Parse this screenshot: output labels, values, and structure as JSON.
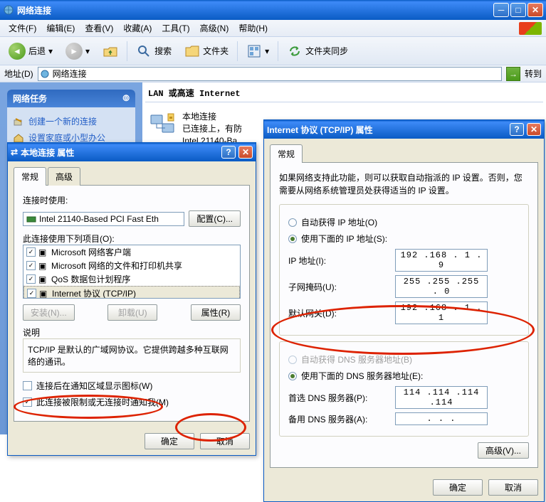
{
  "window": {
    "title": "网络连接"
  },
  "menu": {
    "file": "文件(F)",
    "edit": "编辑(E)",
    "view": "查看(V)",
    "favorites": "收藏(A)",
    "tools": "工具(T)",
    "advanced": "高级(N)",
    "help": "帮助(H)"
  },
  "toolbar": {
    "back": "后退",
    "search": "搜索",
    "folders": "文件夹",
    "sync": "文件夹同步"
  },
  "address": {
    "label": "地址(D)",
    "value": "网络连接",
    "go": "转到"
  },
  "tasks": {
    "header": "网络任务",
    "create": "创建一个新的连接",
    "setup": "设置家庭或小型办公"
  },
  "content": {
    "group": "LAN 或高速 Internet",
    "conn": {
      "name": "本地连接",
      "status": "已连接上，有防",
      "adapter": "Intel 21140-Ba"
    }
  },
  "props": {
    "title": "本地连接 属性",
    "tab_general": "常规",
    "tab_advanced": "高级",
    "connect_using": "连接时使用:",
    "adapter": "Intel 21140-Based PCI Fast Eth",
    "configure": "配置(C)...",
    "uses_items": "此连接使用下列项目(O):",
    "items": [
      "Microsoft 网络客户端",
      "Microsoft 网络的文件和打印机共享",
      "QoS 数据包计划程序",
      "Internet 协议 (TCP/IP)"
    ],
    "install": "安装(N)...",
    "uninstall": "卸载(U)",
    "properties": "属性(R)",
    "desc_label": "说明",
    "desc": "TCP/IP 是默认的广域网协议。它提供跨越多种互联网络的通讯。",
    "show_tray": "连接后在通知区域显示图标(W)",
    "notify": "此连接被限制或无连接时通知我(M)",
    "ok": "确定",
    "cancel": "取消"
  },
  "tcpip": {
    "title": "Internet 协议 (TCP/IP) 属性",
    "tab_general": "常规",
    "intro": "如果网络支持此功能，则可以获取自动指派的 IP 设置。否则，您需要从网络系统管理员处获得适当的 IP 设置。",
    "auto_ip": "自动获得 IP 地址(O)",
    "use_ip": "使用下面的 IP 地址(S):",
    "ip_label": "IP 地址(I):",
    "ip_value": "192 .168 . 1  . 9",
    "mask_label": "子网掩码(U):",
    "mask_value": "255 .255 .255 . 0",
    "gw_label": "默认网关(D):",
    "gw_value": "192 .168 . 1  . 1",
    "auto_dns": "自动获得 DNS 服务器地址(B)",
    "use_dns": "使用下面的 DNS 服务器地址(E):",
    "dns1_label": "首选 DNS 服务器(P):",
    "dns1_value": "114 .114 .114 .114",
    "dns2_label": "备用 DNS 服务器(A):",
    "dns2_value": "   .   .   .   ",
    "advanced": "高级(V)...",
    "ok": "确定",
    "cancel": "取消"
  }
}
